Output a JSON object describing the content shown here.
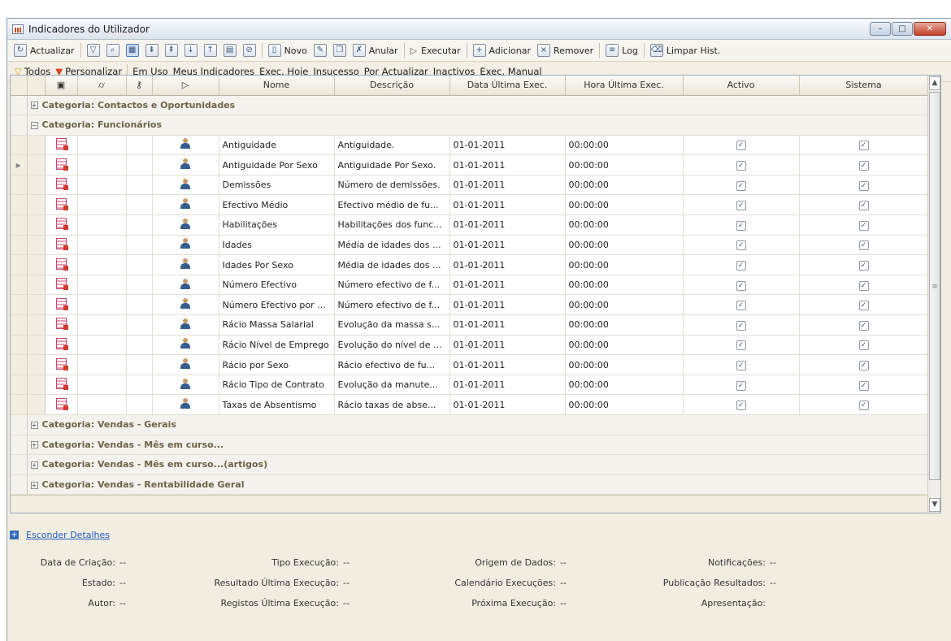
{
  "window": {
    "title": "Indicadores do Utilizador"
  },
  "window_buttons": {
    "minimize": "–",
    "maximize": "□",
    "close": "✕"
  },
  "toolbar": {
    "refresh": "Actualizar",
    "new": "Novo",
    "cancel": "Anular",
    "execute": "Executar",
    "add": "Adicionar",
    "remove": "Remover",
    "log": "Log",
    "clear_history": "Limpar Hist."
  },
  "filterbar": {
    "all": "Todos",
    "customize": "Personalizar",
    "items": [
      "Em Uso",
      "Meus Indicadores",
      "Exec. Hoje",
      "Insucesso",
      "Por Actualizar",
      "Inactivos",
      "Exec. Manual"
    ]
  },
  "grid": {
    "columns": [
      "",
      "",
      "",
      "",
      "Nome",
      "Descrição",
      "Data Última Exec.",
      "Hora Última Exec.",
      "Activo",
      "Sistema"
    ],
    "groups_before": [
      {
        "label": "Categoria: Contactos e Oportunidades",
        "expanded": false
      }
    ],
    "open_group": {
      "label": "Categoria: Funcionários",
      "expanded": true
    },
    "rows": [
      {
        "nome": "Antiguidade",
        "descricao": "Antiguidade.",
        "data": "01-01-2011",
        "hora": "00:00:00",
        "activo": true,
        "sistema": true
      },
      {
        "nome": "Antiguidade Por Sexo",
        "descricao": "Antiguidade Por Sexo.",
        "data": "01-01-2011",
        "hora": "00:00:00",
        "activo": true,
        "sistema": true,
        "current": true
      },
      {
        "nome": "Demissões",
        "descricao": "Número de demissões.",
        "data": "01-01-2011",
        "hora": "00:00:00",
        "activo": true,
        "sistema": true
      },
      {
        "nome": "Efectivo Médio",
        "descricao": "Efectivo médio de fu...",
        "data": "01-01-2011",
        "hora": "00:00:00",
        "activo": true,
        "sistema": true
      },
      {
        "nome": "Habilitações",
        "descricao": "Habilitações dos func...",
        "data": "01-01-2011",
        "hora": "00:00:00",
        "activo": true,
        "sistema": true
      },
      {
        "nome": "Idades",
        "descricao": "Média de idades dos ...",
        "data": "01-01-2011",
        "hora": "00:00:00",
        "activo": true,
        "sistema": true
      },
      {
        "nome": "Idades Por Sexo",
        "descricao": "Média de idades dos ...",
        "data": "01-01-2011",
        "hora": "00:00:00",
        "activo": true,
        "sistema": true
      },
      {
        "nome": "Número Efectivo",
        "descricao": "Número efectivo de f...",
        "data": "01-01-2011",
        "hora": "00:00:00",
        "activo": true,
        "sistema": true
      },
      {
        "nome": "Número Efectivo por ...",
        "descricao": "Número efectivo de f...",
        "data": "01-01-2011",
        "hora": "00:00:00",
        "activo": true,
        "sistema": true
      },
      {
        "nome": "Rácio Massa Salarial",
        "descricao": "Evolução da massa s...",
        "data": "01-01-2011",
        "hora": "00:00:00",
        "activo": true,
        "sistema": true
      },
      {
        "nome": "Rácio Nível de Emprego",
        "descricao": "Evolução do nível de ...",
        "data": "01-01-2011",
        "hora": "00:00:00",
        "activo": true,
        "sistema": true
      },
      {
        "nome": "Rácio por Sexo",
        "descricao": "Rácio efectivo de fu...",
        "data": "01-01-2011",
        "hora": "00:00:00",
        "activo": true,
        "sistema": true
      },
      {
        "nome": "Rácio Tipo de Contrato",
        "descricao": "Evolução da manute...",
        "data": "01-01-2011",
        "hora": "00:00:00",
        "activo": true,
        "sistema": true
      },
      {
        "nome": "Taxas de Absentismo",
        "descricao": "Rácio taxas de abse...",
        "data": "01-01-2011",
        "hora": "00:00:00",
        "activo": true,
        "sistema": true
      }
    ],
    "groups_after": [
      {
        "label": "Categoria: Vendas - Gerais",
        "expanded": false
      },
      {
        "label": "Categoria: Vendas - Mês em curso...",
        "expanded": false
      },
      {
        "label": "Categoria: Vendas - Mês em curso...(artigos)",
        "expanded": false
      },
      {
        "label": "Categoria: Vendas - Rentabilidade Geral",
        "expanded": false
      }
    ]
  },
  "details": {
    "toggle_label": "Esconder Detalhes",
    "fields": [
      {
        "label": "Data de Criação:",
        "value": "--"
      },
      {
        "label": "Tipo Execução:",
        "value": "--"
      },
      {
        "label": "Origem de Dados:",
        "value": "--"
      },
      {
        "label": "Notificações:",
        "value": "--"
      },
      {
        "label": "Estado:",
        "value": "--"
      },
      {
        "label": "Resultado Última Execução:",
        "value": "--"
      },
      {
        "label": "Calendário Execuções:",
        "value": "--"
      },
      {
        "label": "Publicação Resultados:",
        "value": "--"
      },
      {
        "label": "Autor:",
        "value": "--"
      },
      {
        "label": "Registos Última Execução:",
        "value": "--"
      },
      {
        "label": "Próxima Execução:",
        "value": "--"
      },
      {
        "label": "Apresentação:",
        "value": ""
      }
    ]
  }
}
